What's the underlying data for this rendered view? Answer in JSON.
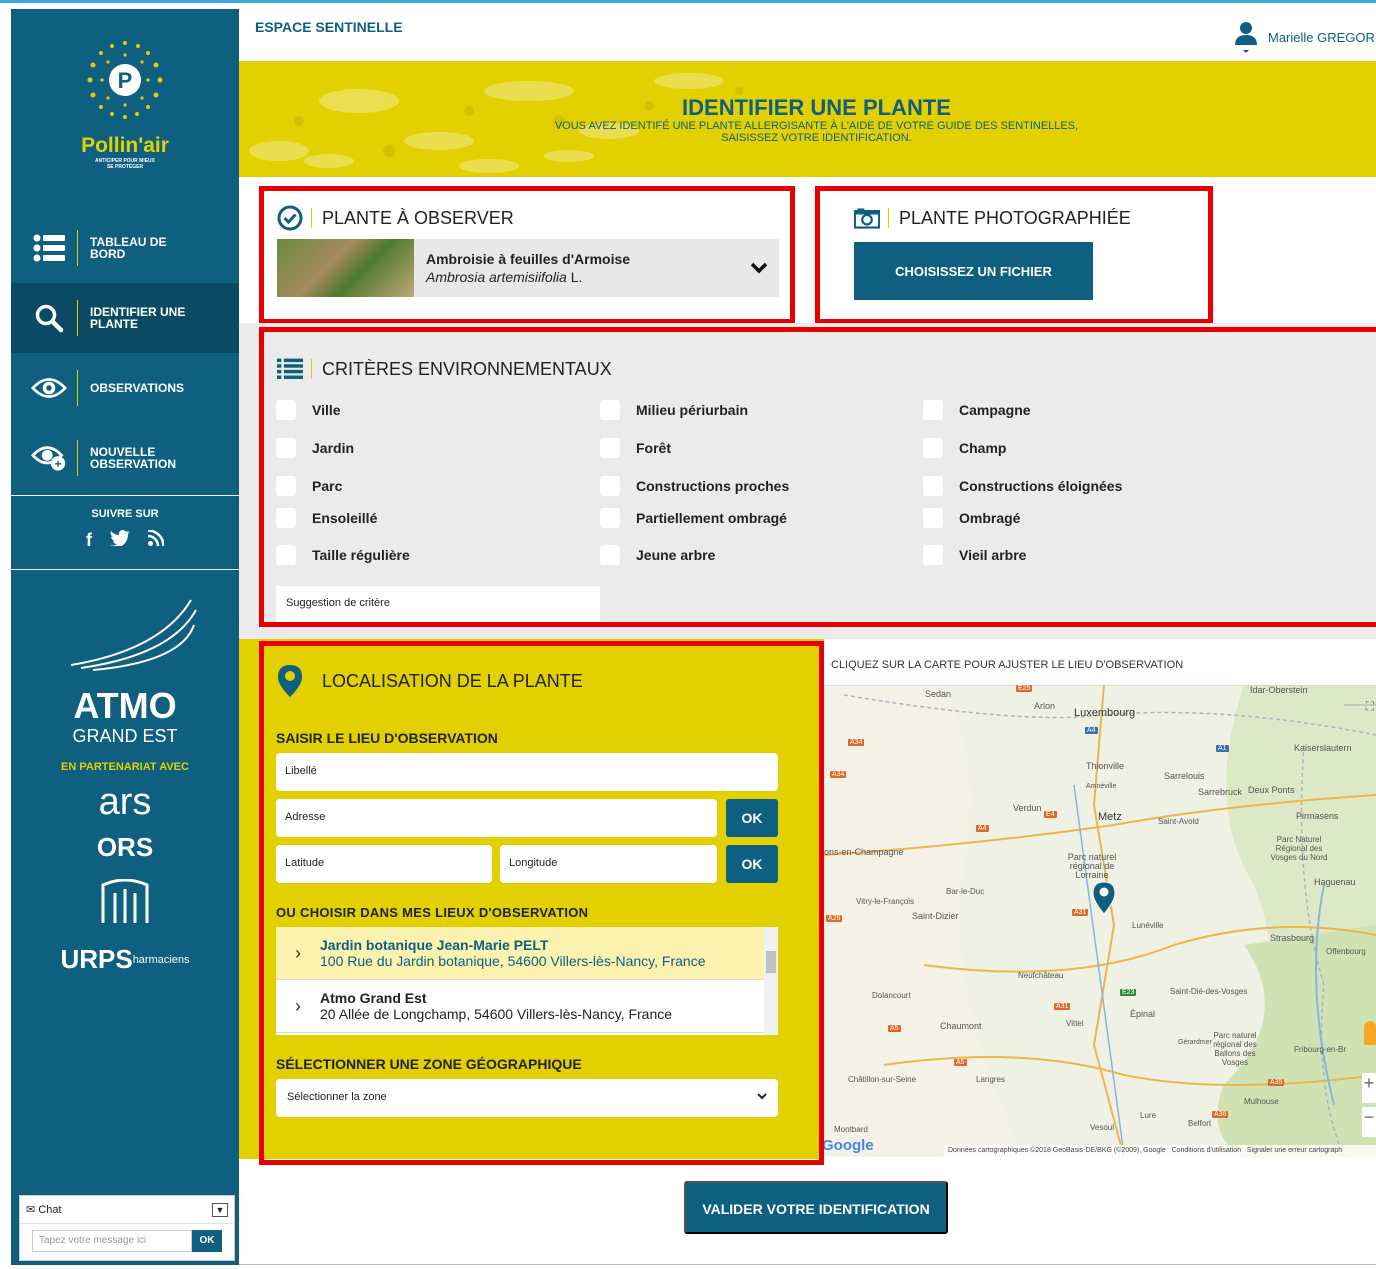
{
  "sidebar": {
    "brand": "Pollin'air",
    "brand_tagline_1": "ANTICIPER POUR MIEUX",
    "brand_tagline_2": "SE PROTÉGER",
    "nav": [
      {
        "line1": "TABLEAU DE",
        "line2": "BORD"
      },
      {
        "line1": "IDENTIFIER UNE",
        "line2": "PLANTE"
      },
      {
        "line1": "OBSERVATIONS",
        "line2": ""
      },
      {
        "line1": "NOUVELLE",
        "line2": "OBSERVATION"
      }
    ],
    "follow_title": "SUIVRE SUR",
    "partner_label": "EN PARTENARIAT AVEC",
    "atmo_title": "ATMO",
    "atmo_sub": "GRAND EST",
    "ars": "ars",
    "ors": "ORS",
    "urps": "URPS",
    "urps_sub": "harmaciens"
  },
  "chat": {
    "title": "Chat",
    "placeholder": "Tapez votre message ici",
    "ok": "OK"
  },
  "header": {
    "space": "ESPACE SENTINELLE",
    "user_name": "Marielle GREGOR"
  },
  "banner": {
    "title": "IDENTIFIER UNE PLANTE",
    "sub_1": "VOUS AVEZ IDENTIFÉ UNE PLANTE ALLERGISANTE À L'AIDE DE VOTRE GUIDE DES SENTINELLES,",
    "sub_2": "SAISISSEZ VOTRE IDENTIFICATION."
  },
  "plant": {
    "title": "PLANTE À OBSERVER",
    "common": "Ambroisie à feuilles d'Armoise",
    "latin": "Ambrosia artemisiifolia",
    "author": "L."
  },
  "photo": {
    "title": "PLANTE PHOTOGRAPHIÉE",
    "button": "CHOISISSEZ UN FICHIER"
  },
  "criteria": {
    "title": "CRITÈRES ENVIRONNEMENTAUX",
    "col1": [
      "Ville",
      "Jardin",
      "Parc",
      "Ensoleillé",
      "Taille régulière"
    ],
    "col2": [
      "Milieu périurbain",
      "Forêt",
      "Constructions proches",
      "Partiellement ombragé",
      "Jeune arbre"
    ],
    "col3": [
      "Campagne",
      "Champ",
      "Constructions éloignées",
      "Ombragé",
      "Vieil arbre"
    ],
    "suggestion": "Suggestion de critère"
  },
  "location": {
    "title": "LOCALISATION DE LA PLANTE",
    "enter_label": "SAISIR LE LIEU D'OBSERVATION",
    "libelle": "Libellé",
    "adresse": "Adresse",
    "latitude": "Latitude",
    "longitude": "Longitude",
    "ok": "OK",
    "choose_label": "OU CHOISIR DANS MES LIEUX D'OBSERVATION",
    "places": [
      {
        "name": "Jardin botanique Jean-Marie PELT",
        "address": "100 Rue du Jardin botanique, 54600 Villers-lès-Nancy, France"
      },
      {
        "name": "Atmo Grand Est",
        "address": "20 Allée de Longchamp, 54600 Villers-lès-Nancy, France"
      }
    ],
    "zone_label": "SÉLECTIONNER UNE ZONE GÉOGRAPHIQUE",
    "zone_placeholder": "Sélectionner la zone"
  },
  "map": {
    "hint": "CLIQUEZ SUR LA CARTE POUR AJUSTER LE LIEU D'OBSERVATION",
    "places": [
      "Sedan",
      "Arlon",
      "Luxembourg",
      "Idar-Oberstein",
      "Kaiserslautern",
      "Thionville",
      "Sarrelouis",
      "Sarrebruck",
      "Deux Ponts",
      "Amnéville",
      "Pirmasens",
      "Verdun",
      "Metz",
      "Saint-Avold",
      "ons-en-Champagne",
      "Parc naturel régional de Lorraine",
      "Parc Naturel Régional des Vosges du Nord",
      "Haguenau",
      "Bar-le-Duc",
      "Vitry-le-François",
      "Saint-Dizier",
      "Lunéville",
      "Strasbourg",
      "Offenbourg",
      "Neufchâteau",
      "Dolancourt",
      "Saint-Dié-des-Vosges",
      "Épinal",
      "Chaumont",
      "Vittel",
      "Gérardmer",
      "Parc naturel régional des Ballons des Vosges",
      "Fribourg-en-Br",
      "Châtillon-sur-Seine",
      "Langres",
      "Mulhouse",
      "Lure",
      "Belfort",
      "Montbard",
      "Vesoul"
    ],
    "google": "Google",
    "attribution": "Données cartographiques ©2018 GeoBasis-DE/BKG (©2009), Google",
    "terms": "Conditions d'utilisation",
    "report": "Signaler une erreur cartograph"
  },
  "validate": "VALIDER VOTRE IDENTIFICATION"
}
